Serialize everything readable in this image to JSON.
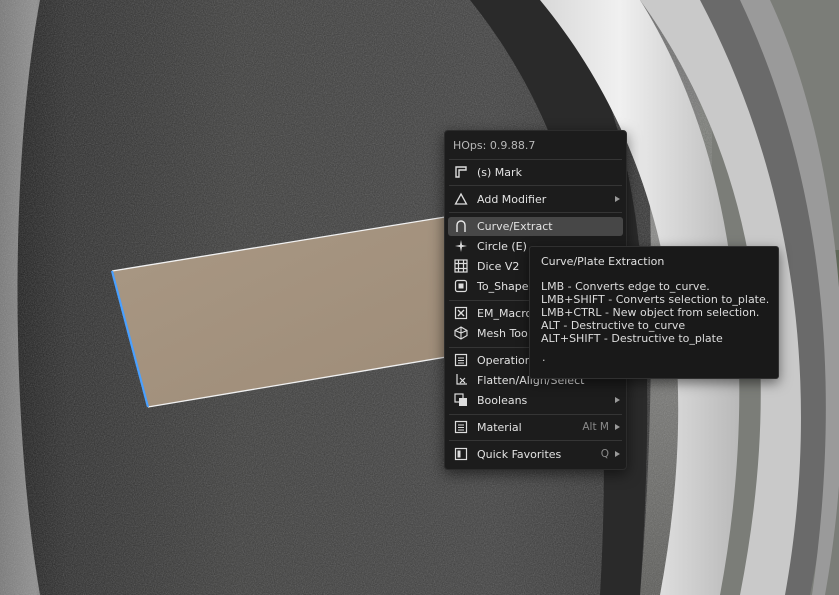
{
  "menu": {
    "title": "HOps: 0.9.88.7",
    "items": [
      {
        "label": "(s) Mark",
        "icon": "mark-icon"
      },
      {
        "label": "Add Modifier",
        "icon": "triangle-icon",
        "submenu": true
      },
      {
        "label": "Curve/Extract",
        "icon": "curve-icon",
        "active": true
      },
      {
        "label": "Circle (E)",
        "icon": "sparkle-icon"
      },
      {
        "label": "Dice V2",
        "icon": "grid-icon"
      },
      {
        "label": "To_Shape",
        "icon": "to-shape-icon"
      },
      {
        "label": "EM_Macro",
        "icon": "macro-icon"
      },
      {
        "label": "Mesh Too",
        "icon": "mesh-tools-icon"
      },
      {
        "label": "Operation",
        "icon": "operations-icon"
      },
      {
        "label": "Flatten/Align/Select",
        "icon": "flatten-icon"
      },
      {
        "label": "Booleans",
        "icon": "booleans-icon",
        "submenu": true
      },
      {
        "label": "Material",
        "icon": "material-icon",
        "hotkey": "Alt M",
        "submenu": true
      },
      {
        "label": "Quick Favorites",
        "icon": "favorites-icon",
        "hotkey": "Q",
        "submenu": true
      }
    ]
  },
  "tooltip": {
    "title": "Curve/Plate Extraction",
    "lines": [
      "LMB - Converts edge to_curve.",
      "LMB+SHIFT - Converts selection to_plate.",
      "LMB+CTRL - New object from selection.",
      "ALT - Destructive to_curve",
      "ALT+SHIFT - Destructive to_plate"
    ],
    "trailing": "."
  },
  "colors": {
    "menu_bg": "#1c1c1c",
    "active_bg": "#474747",
    "selection_face": "#a89680",
    "selected_edge": "#4aa0ff"
  }
}
